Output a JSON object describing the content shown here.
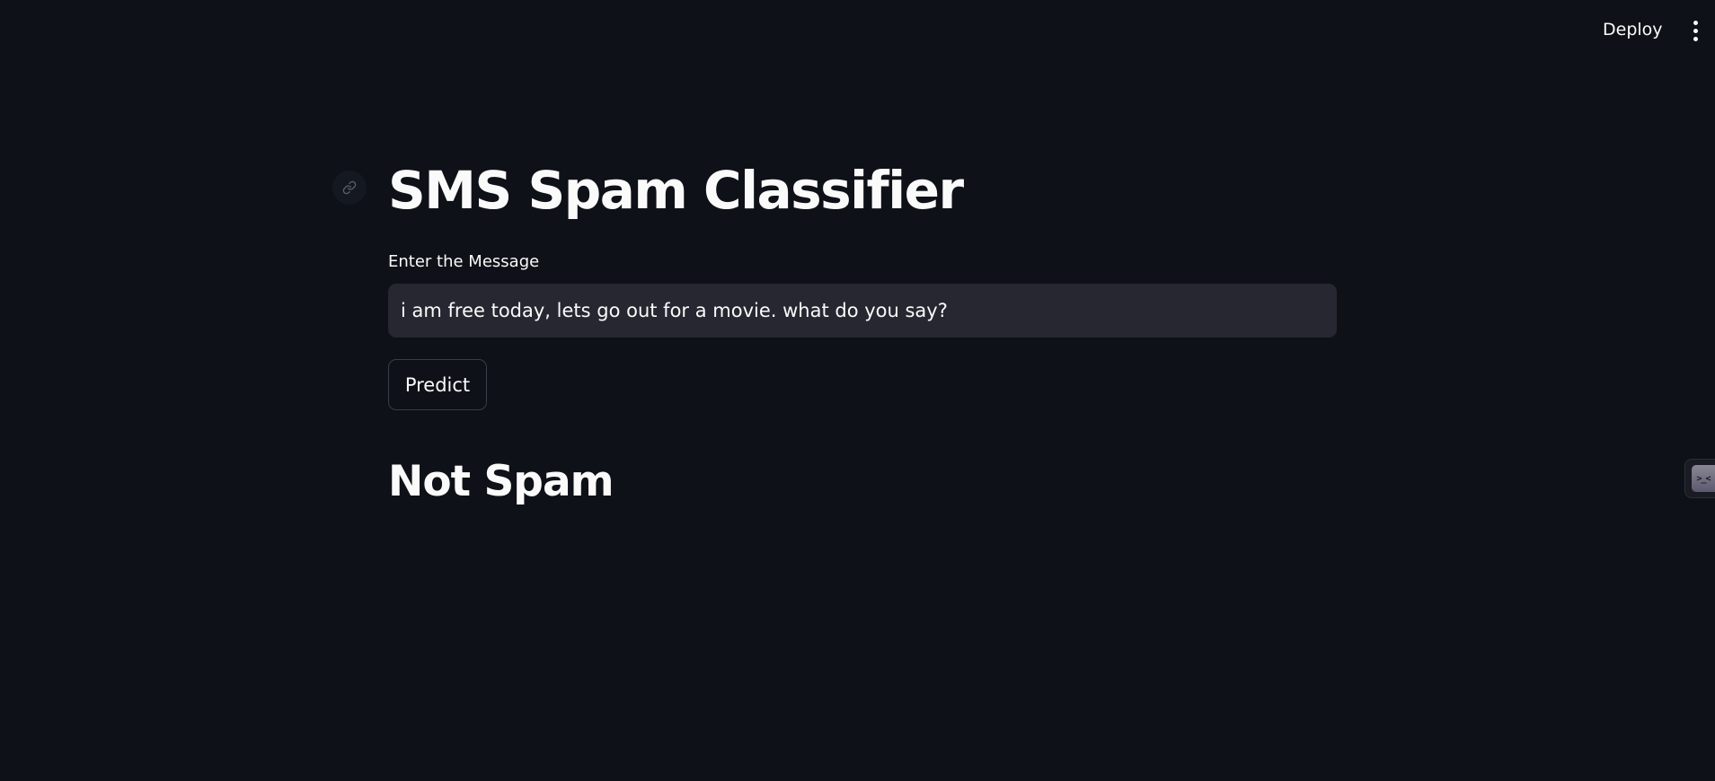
{
  "header": {
    "deploy_label": "Deploy",
    "menu_icon": "kebab-menu-icon"
  },
  "main": {
    "title": "SMS Spam Classifier",
    "anchor_icon": "link-icon",
    "input_label": "Enter the Message",
    "input_value": "i am free today, lets go out for a movie. what do you say?",
    "predict_label": "Predict",
    "result": "Not Spam"
  },
  "side_widget": {
    "face": ">_<"
  },
  "colors": {
    "background": "#0e1117",
    "input_background": "#262730",
    "text": "#fafafa",
    "button_border": "#3a3d46"
  }
}
